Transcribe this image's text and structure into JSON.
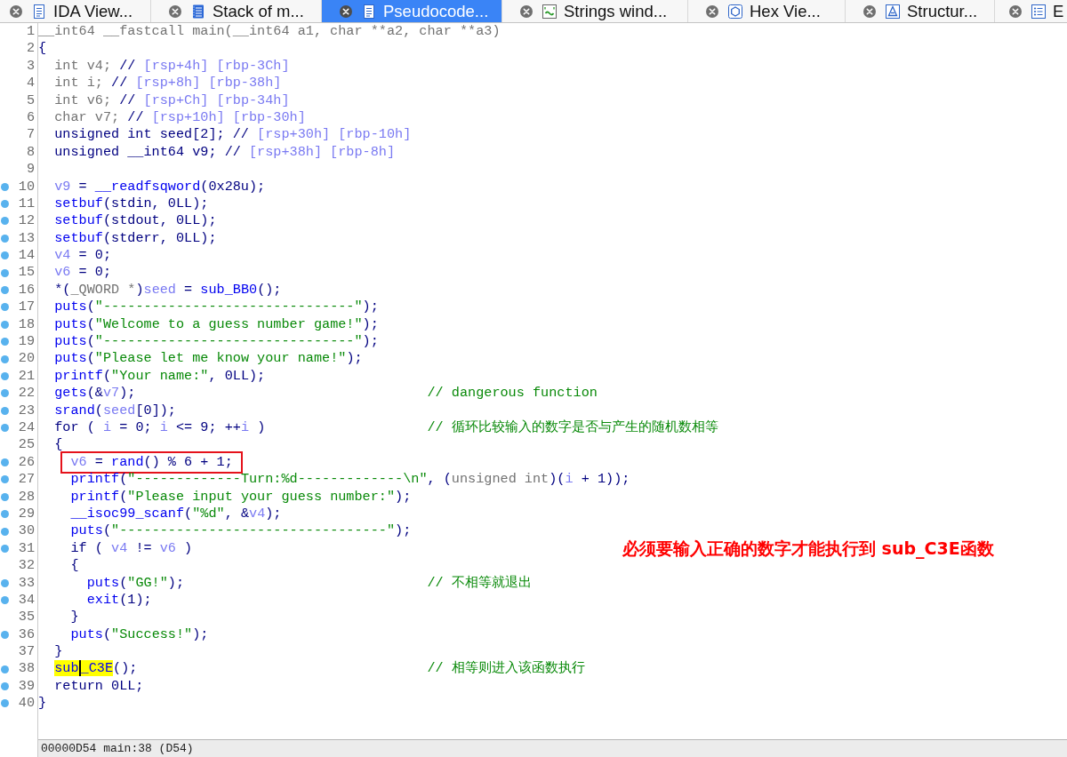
{
  "tabs": [
    {
      "kind": "disassembly",
      "label": "IDA View...",
      "selected": false
    },
    {
      "kind": "stack",
      "label": "Stack of m...",
      "selected": false
    },
    {
      "kind": "pseudocode",
      "label": "Pseudocode...",
      "selected": true
    },
    {
      "kind": "strings",
      "label": "Strings wind...",
      "selected": false
    },
    {
      "kind": "hex",
      "label": "Hex Vie...",
      "selected": false
    },
    {
      "kind": "structures",
      "label": "Structur...",
      "selected": false
    },
    {
      "kind": "enums",
      "label": "E",
      "selected": false
    }
  ],
  "code": {
    "lines": [
      {
        "number": "1",
        "marker": false,
        "boxed": false,
        "tokens": [
          {
            "kind": "type",
            "text": "__int64 __fastcall main(__int64 a1, char **a2, char **a3)"
          }
        ]
      },
      {
        "number": "2",
        "marker": false,
        "boxed": false,
        "tokens": [
          {
            "kind": "text",
            "text": "{"
          }
        ]
      },
      {
        "number": "3",
        "marker": false,
        "boxed": false,
        "tokens": [
          {
            "kind": "type",
            "text": "  int v4;"
          },
          {
            "kind": "text",
            "text": " // "
          },
          {
            "kind": "offset",
            "text": "[rsp+4h] [rbp-3Ch]"
          }
        ]
      },
      {
        "number": "4",
        "marker": false,
        "boxed": false,
        "tokens": [
          {
            "kind": "type",
            "text": "  int i;"
          },
          {
            "kind": "text",
            "text": " // "
          },
          {
            "kind": "offset",
            "text": "[rsp+8h] [rbp-38h]"
          }
        ]
      },
      {
        "number": "5",
        "marker": false,
        "boxed": false,
        "tokens": [
          {
            "kind": "type",
            "text": "  int v6;"
          },
          {
            "kind": "text",
            "text": " // "
          },
          {
            "kind": "offset",
            "text": "[rsp+Ch] [rbp-34h]"
          }
        ]
      },
      {
        "number": "6",
        "marker": false,
        "boxed": false,
        "tokens": [
          {
            "kind": "type",
            "text": "  char v7;"
          },
          {
            "kind": "text",
            "text": " // "
          },
          {
            "kind": "offset",
            "text": "[rsp+10h] [rbp-30h]"
          }
        ]
      },
      {
        "number": "7",
        "marker": false,
        "boxed": false,
        "tokens": [
          {
            "kind": "text",
            "text": "  unsigned int seed[2]; // "
          },
          {
            "kind": "offset",
            "text": "[rsp+30h] [rbp-10h]"
          }
        ]
      },
      {
        "number": "8",
        "marker": false,
        "boxed": false,
        "tokens": [
          {
            "kind": "text",
            "text": "  unsigned __int64 v9; // "
          },
          {
            "kind": "offset",
            "text": "[rsp+38h] [rbp-8h]"
          }
        ]
      },
      {
        "number": "9",
        "marker": false,
        "boxed": false
      },
      {
        "number": "10",
        "marker": true,
        "boxed": false,
        "tokens": [
          {
            "kind": "variable",
            "text": "  v9"
          },
          {
            "kind": "text",
            "text": " = "
          },
          {
            "kind": "function",
            "text": "__readfsqword"
          },
          {
            "kind": "text",
            "text": "(0x28u);"
          }
        ]
      },
      {
        "number": "11",
        "marker": true,
        "boxed": false,
        "tokens": [
          {
            "kind": "function",
            "text": "  setbuf"
          },
          {
            "kind": "text",
            "text": "(stdin, 0LL);"
          }
        ]
      },
      {
        "number": "12",
        "marker": true,
        "boxed": false,
        "tokens": [
          {
            "kind": "function",
            "text": "  setbuf"
          },
          {
            "kind": "text",
            "text": "(stdout, 0LL);"
          }
        ]
      },
      {
        "number": "13",
        "marker": true,
        "boxed": false,
        "tokens": [
          {
            "kind": "function",
            "text": "  setbuf"
          },
          {
            "kind": "text",
            "text": "(stderr, 0LL);"
          }
        ]
      },
      {
        "number": "14",
        "marker": true,
        "boxed": false,
        "tokens": [
          {
            "kind": "variable",
            "text": "  v4"
          },
          {
            "kind": "text",
            "text": " = 0;"
          }
        ]
      },
      {
        "number": "15",
        "marker": true,
        "boxed": false,
        "tokens": [
          {
            "kind": "variable",
            "text": "  v6"
          },
          {
            "kind": "text",
            "text": " = 0;"
          }
        ]
      },
      {
        "number": "16",
        "marker": true,
        "boxed": false,
        "tokens": [
          {
            "kind": "text",
            "text": "  *("
          },
          {
            "kind": "type",
            "text": "_QWORD *"
          },
          {
            "kind": "text",
            "text": ")"
          },
          {
            "kind": "variable",
            "text": "seed"
          },
          {
            "kind": "text",
            "text": " = "
          },
          {
            "kind": "function",
            "text": "sub_BB0"
          },
          {
            "kind": "text",
            "text": "();"
          }
        ]
      },
      {
        "number": "17",
        "marker": true,
        "boxed": false,
        "tokens": [
          {
            "kind": "function",
            "text": "  puts"
          },
          {
            "kind": "text",
            "text": "("
          },
          {
            "kind": "string",
            "text": "\"-------------------------------\""
          },
          {
            "kind": "text",
            "text": ");"
          }
        ]
      },
      {
        "number": "18",
        "marker": true,
        "boxed": false,
        "tokens": [
          {
            "kind": "function",
            "text": "  puts"
          },
          {
            "kind": "text",
            "text": "("
          },
          {
            "kind": "string",
            "text": "\"Welcome to a guess number game!\""
          },
          {
            "kind": "text",
            "text": ");"
          }
        ]
      },
      {
        "number": "19",
        "marker": true,
        "boxed": false,
        "tokens": [
          {
            "kind": "function",
            "text": "  puts"
          },
          {
            "kind": "text",
            "text": "("
          },
          {
            "kind": "string",
            "text": "\"-------------------------------\""
          },
          {
            "kind": "text",
            "text": ");"
          }
        ]
      },
      {
        "number": "20",
        "marker": true,
        "boxed": false,
        "tokens": [
          {
            "kind": "function",
            "text": "  puts"
          },
          {
            "kind": "text",
            "text": "("
          },
          {
            "kind": "string",
            "text": "\"Please let me know your name!\""
          },
          {
            "kind": "text",
            "text": ");"
          }
        ]
      },
      {
        "number": "21",
        "marker": true,
        "boxed": false,
        "tokens": [
          {
            "kind": "function",
            "text": "  printf"
          },
          {
            "kind": "text",
            "text": "("
          },
          {
            "kind": "string",
            "text": "\"Your name:\""
          },
          {
            "kind": "text",
            "text": ", 0LL);"
          }
        ]
      },
      {
        "number": "22",
        "marker": true,
        "boxed": false,
        "tokens": [
          {
            "kind": "function",
            "text": "  gets"
          },
          {
            "kind": "text",
            "text": "(&"
          },
          {
            "kind": "variable",
            "text": "v7"
          },
          {
            "kind": "text",
            "text": ");"
          }
        ],
        "comment": "// dangerous function"
      },
      {
        "number": "23",
        "marker": true,
        "boxed": false,
        "tokens": [
          {
            "kind": "function",
            "text": "  srand"
          },
          {
            "kind": "text",
            "text": "("
          },
          {
            "kind": "variable",
            "text": "seed"
          },
          {
            "kind": "text",
            "text": "[0]);"
          }
        ]
      },
      {
        "number": "24",
        "marker": true,
        "boxed": false,
        "tokens": [
          {
            "kind": "text",
            "text": "  for ( "
          },
          {
            "kind": "variable",
            "text": "i"
          },
          {
            "kind": "text",
            "text": " = 0; "
          },
          {
            "kind": "variable",
            "text": "i"
          },
          {
            "kind": "text",
            "text": " <= 9; ++"
          },
          {
            "kind": "variable",
            "text": "i"
          },
          {
            "kind": "text",
            "text": " )"
          }
        ],
        "comment": "// 循环比较输入的数字是否与产生的随机数相等"
      },
      {
        "number": "25",
        "marker": false,
        "boxed": false,
        "tokens": [
          {
            "kind": "text",
            "text": "  {"
          }
        ]
      },
      {
        "number": "26",
        "marker": true,
        "boxed": true,
        "tokens": [
          {
            "kind": "variable",
            "text": "    v6"
          },
          {
            "kind": "text",
            "text": " = "
          },
          {
            "kind": "function",
            "text": "rand"
          },
          {
            "kind": "text",
            "text": "() % 6 + 1;"
          }
        ]
      },
      {
        "number": "27",
        "marker": true,
        "boxed": false,
        "tokens": [
          {
            "kind": "function",
            "text": "    printf"
          },
          {
            "kind": "text",
            "text": "("
          },
          {
            "kind": "string",
            "text": "\"-------------Turn:%d-------------\\n\""
          },
          {
            "kind": "text",
            "text": ", ("
          },
          {
            "kind": "type",
            "text": "unsigned int"
          },
          {
            "kind": "text",
            "text": ")("
          },
          {
            "kind": "variable",
            "text": "i"
          },
          {
            "kind": "text",
            "text": " + 1));"
          }
        ]
      },
      {
        "number": "28",
        "marker": true,
        "boxed": false,
        "tokens": [
          {
            "kind": "function",
            "text": "    printf"
          },
          {
            "kind": "text",
            "text": "("
          },
          {
            "kind": "string",
            "text": "\"Please input your guess number:\""
          },
          {
            "kind": "text",
            "text": ");"
          }
        ]
      },
      {
        "number": "29",
        "marker": true,
        "boxed": false,
        "tokens": [
          {
            "kind": "function",
            "text": "    __isoc99_scanf"
          },
          {
            "kind": "text",
            "text": "("
          },
          {
            "kind": "string",
            "text": "\"%d\""
          },
          {
            "kind": "text",
            "text": ", &"
          },
          {
            "kind": "variable",
            "text": "v4"
          },
          {
            "kind": "text",
            "text": ");"
          }
        ]
      },
      {
        "number": "30",
        "marker": true,
        "boxed": false,
        "tokens": [
          {
            "kind": "function",
            "text": "    puts"
          },
          {
            "kind": "text",
            "text": "("
          },
          {
            "kind": "string",
            "text": "\"---------------------------------\""
          },
          {
            "kind": "text",
            "text": ");"
          }
        ]
      },
      {
        "number": "31",
        "marker": true,
        "boxed": false,
        "tokens": [
          {
            "kind": "text",
            "text": "    if ( "
          },
          {
            "kind": "variable",
            "text": "v4"
          },
          {
            "kind": "text",
            "text": " != "
          },
          {
            "kind": "variable",
            "text": "v6"
          },
          {
            "kind": "text",
            "text": " )"
          }
        ],
        "note": "必须要输入正确的数字才能执行到 sub_C3E函数"
      },
      {
        "number": "32",
        "marker": false,
        "boxed": false,
        "tokens": [
          {
            "kind": "text",
            "text": "    {"
          }
        ]
      },
      {
        "number": "33",
        "marker": true,
        "boxed": false,
        "tokens": [
          {
            "kind": "function",
            "text": "      puts"
          },
          {
            "kind": "text",
            "text": "("
          },
          {
            "kind": "string",
            "text": "\"GG!\""
          },
          {
            "kind": "text",
            "text": ");"
          }
        ],
        "comment": "// 不相等就退出"
      },
      {
        "number": "34",
        "marker": true,
        "boxed": false,
        "tokens": [
          {
            "kind": "function",
            "text": "      exit"
          },
          {
            "kind": "text",
            "text": "(1);"
          }
        ]
      },
      {
        "number": "35",
        "marker": false,
        "boxed": false,
        "tokens": [
          {
            "kind": "text",
            "text": "    }"
          }
        ]
      },
      {
        "number": "36",
        "marker": true,
        "boxed": false,
        "tokens": [
          {
            "kind": "function",
            "text": "    puts"
          },
          {
            "kind": "text",
            "text": "("
          },
          {
            "kind": "string",
            "text": "\"Success!\""
          },
          {
            "kind": "text",
            "text": ");"
          }
        ]
      },
      {
        "number": "37",
        "marker": false,
        "boxed": false,
        "tokens": [
          {
            "kind": "text",
            "text": "  }"
          }
        ]
      },
      {
        "number": "38",
        "marker": true,
        "boxed": false,
        "tokens": [
          {
            "kind": "highlight",
            "text": "  sub"
          },
          {
            "kind": "caret",
            "text": "_C3E"
          },
          {
            "kind": "text",
            "text": "();"
          }
        ],
        "comment": "// 相等则进入该函数执行"
      },
      {
        "number": "39",
        "marker": true,
        "boxed": false,
        "tokens": [
          {
            "kind": "text",
            "text": "  return 0LL;"
          }
        ]
      },
      {
        "number": "40",
        "marker": true,
        "boxed": false,
        "tokens": [
          {
            "kind": "text",
            "text": "}"
          }
        ]
      }
    ]
  },
  "status_bar": {
    "text": "00000D54 main:38 (D54)"
  }
}
